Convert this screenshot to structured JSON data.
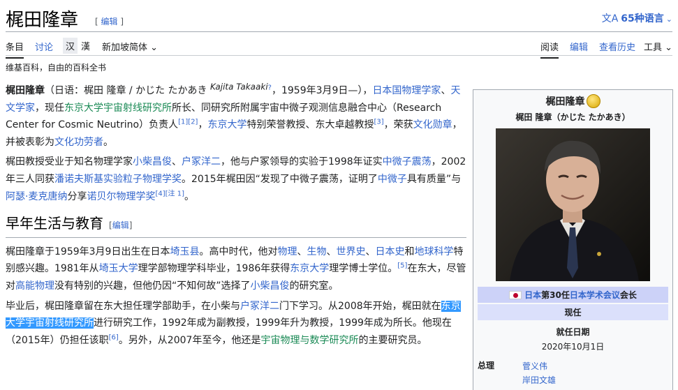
{
  "header": {
    "title": "梶田隆章",
    "edit_open": "[",
    "edit_label": "编辑",
    "edit_close": "]",
    "lang_glyph": "文A",
    "lang_label": "65种语言",
    "lang_chevron": "⌄"
  },
  "tabs": {
    "article": "条目",
    "talk": "讨论",
    "script_simplified": "汉",
    "script_traditional": "漢",
    "variant": "新加坡简体",
    "read": "阅读",
    "edit": "编辑",
    "history": "查看历史",
    "tools": "工具"
  },
  "tagline": "维基百科，自由的百科全书",
  "lead": {
    "p1": {
      "name": "梶田隆章",
      "t1": "（日语：梶田 隆章 / かじた たかあき ",
      "romaji": "Kajita Takaaki",
      "q": "?",
      "t2": "，1959年3月9日—），",
      "l1": "日本国物理学家",
      "t3": "、",
      "l2": "天文学家",
      "t4": "，现任",
      "l3": "东京大学宇宙射线研究所",
      "t5": "所长、同研究所附属宇宙中微子观测信息融合中心（Research Center for Cosmic Neutrino）负责人",
      "r1": "[1]",
      "r2": "[2]",
      "t6": "，",
      "l4": "东京大学",
      "t7": "特别荣誉教授、东大卓越教授",
      "r3": "[3]",
      "t8": "，荣获",
      "l5": "文化勋章",
      "t9": "，并被表彰为",
      "l6": "文化功劳者",
      "t10": "。"
    },
    "p2": {
      "t1": "梶田教授受业于知名物理学家",
      "l1": "小柴昌俊",
      "t2": "、",
      "l2": "户冢洋二",
      "t3": "，他与户冢领导的实验于1998年证实",
      "l3": "中微子震荡",
      "t4": "，2002年三人同获",
      "l4": "潘诺夫斯基实验粒子物理学奖",
      "t5": "。2015年梶田因“发现了中微子震荡，证明了",
      "l5": "中微子",
      "t6": "具有质量”与",
      "l6": "阿瑟·麦克唐纳",
      "t7": "分享",
      "l7": "诺贝尔物理学奖",
      "r1": "[4]",
      "r2": "[注 1]",
      "t8": "。"
    }
  },
  "section1": {
    "heading": "早年生活与教育",
    "edit_open": "[",
    "edit_label": "编辑",
    "edit_close": "]",
    "p1": {
      "t1": "梶田隆章于1959年3月9日出生在日本",
      "l1": "埼玉县",
      "t2": "。高中时代，他对",
      "l2": "物理",
      "t3": "、",
      "l3": "生物",
      "t4": "、",
      "l4": "世界史",
      "t5": "、",
      "l5": "日本史",
      "t6": "和",
      "l6": "地球科学",
      "t7": "特别感兴趣。1981年从",
      "l7": "埼玉大学",
      "t8": "理学部物理学科毕业，1986年获得",
      "l8": "东京大学",
      "t9": "理学博士学位。",
      "r1": "[5]",
      "t10": "在东大，尽管对",
      "l9": "高能物理",
      "t11": "没有特别的兴趣，但他仍因“不知何故”选择了",
      "l10": "小柴昌俊",
      "t12": "的研究室。"
    },
    "p2": {
      "t1": "毕业后，梶田隆章留在东大担任理学部助手，在小柴与",
      "l1": "户冢洋二",
      "t2": "门下学习。从2008年开始，梶田就在",
      "l2": "东京大学宇宙射线研究所",
      "t3": "进行研究工作，1992年成为副教授，1999年升为教授，1999年成为所长。他现在（2015年）仍担任该职",
      "r1": "[6]",
      "t4": "。另外，从2007年至今，他还是",
      "l3": "宇宙物理与数学研究所",
      "t5": "的主要研究员。"
    }
  },
  "infobox": {
    "name": "梶田隆章",
    "native_name": "梶田 隆章（かじた たかあき）",
    "office_l1": "日本",
    "office_t1": "第30任",
    "office_l2": "日本学术会议",
    "office_t2": "会长",
    "current": "现任",
    "took_office_label": "就任日期",
    "took_office_value": "2020年10月1日",
    "pm_label": "总理",
    "pm_1": "菅义伟",
    "pm_2": "岸田文雄"
  },
  "colors": {
    "link": "#3366cc",
    "visited": "#795cb2",
    "highlight": "#3399ff",
    "office_header": "#ccd2f8"
  }
}
